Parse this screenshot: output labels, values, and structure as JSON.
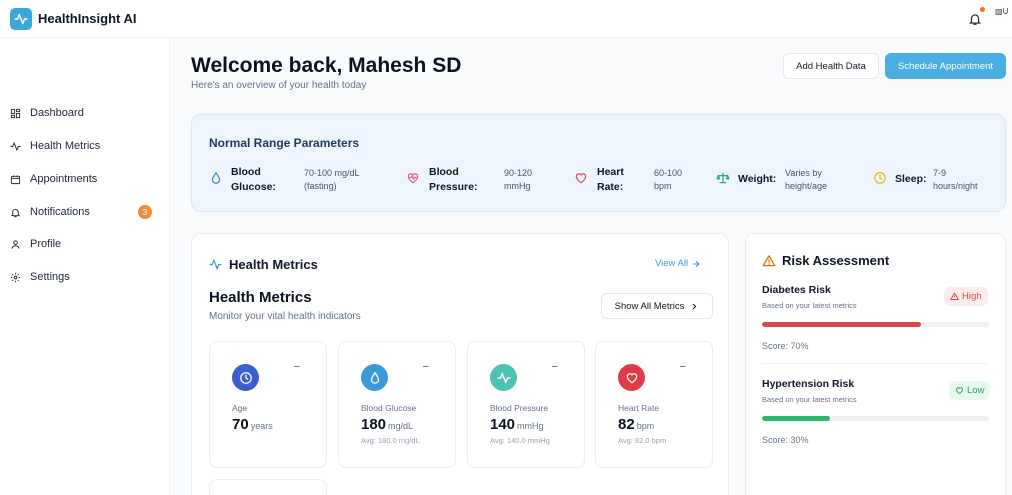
{
  "app": {
    "name": "HealthInsight AI",
    "avatar_alt": "U"
  },
  "sidebar": {
    "items": [
      {
        "label": "Dashboard",
        "icon": "grid-icon"
      },
      {
        "label": "Health Metrics",
        "icon": "activity-icon"
      },
      {
        "label": "Appointments",
        "icon": "calendar-icon"
      },
      {
        "label": "Notifications",
        "icon": "bell-icon",
        "badge": "3"
      },
      {
        "label": "Profile",
        "icon": "user-icon"
      },
      {
        "label": "Settings",
        "icon": "gear-icon"
      }
    ]
  },
  "header": {
    "title": "Welcome back, Mahesh SD",
    "subtitle": "Here's an overview of your health today",
    "add_data_label": "Add Health Data",
    "schedule_label": "Schedule Appointment"
  },
  "normal_range": {
    "title": "Normal Range Parameters",
    "params": [
      {
        "label_1": "Blood",
        "label_2": "Glucose:",
        "value_1": "70-100 mg/dL",
        "value_2": "(fasting)",
        "icon": "droplet-icon",
        "color": "#3b82c4"
      },
      {
        "label_1": "Blood",
        "label_2": "Pressure:",
        "value_1": "90-120",
        "value_2": "mmHg",
        "icon": "heart-pulse-icon",
        "color": "#e05a8c"
      },
      {
        "label_1": "Heart",
        "label_2": "Rate:",
        "value_1": "60-100",
        "value_2": "bpm",
        "icon": "heart-icon",
        "color": "#e0445c"
      },
      {
        "label_1": "Weight:",
        "label_2": "",
        "value_1": "Varies by",
        "value_2": "height/age",
        "icon": "scale-icon",
        "color": "#22a06b"
      },
      {
        "label_1": "Sleep:",
        "label_2": "",
        "value_1": "7-9",
        "value_2": "hours/night",
        "icon": "clock-icon",
        "color": "#eab308"
      }
    ]
  },
  "health_metrics": {
    "heading": "Health Metrics",
    "view_all": "View All",
    "title": "Health Metrics",
    "subtitle": "Monitor your vital health indicators",
    "show_all": "Show All Metrics",
    "cards": [
      {
        "label": "Age",
        "value": "70",
        "unit": "years",
        "avg": "",
        "trend": "–",
        "icon": "clock-icon",
        "color": "#3b5fd0"
      },
      {
        "label": "Blood Glucose",
        "value": "180",
        "unit": "mg/dL",
        "avg": "Avg: 180.0 mg/dL",
        "trend": "–",
        "icon": "droplet-icon",
        "color": "#3a9bd6"
      },
      {
        "label": "Blood Pressure",
        "value": "140",
        "unit": "mmHg",
        "avg": "Avg: 140.0 mmHg",
        "trend": "–",
        "icon": "activity-icon",
        "color": "#4cc2b4"
      },
      {
        "label": "Heart Rate",
        "value": "82",
        "unit": "bpm",
        "avg": "Avg: 82.0 bpm",
        "trend": "–",
        "icon": "heart-icon",
        "color": "#e03a48"
      }
    ]
  },
  "risk": {
    "heading": "Risk Assessment",
    "items": [
      {
        "name": "Diabetes Risk",
        "note": "Based on your latest metrics",
        "level": "High",
        "score_text": "Score: 70%",
        "score": 0.7,
        "color": "#d84a4a",
        "badge_bg": "#fdecec",
        "icon": "alert-triangle-icon"
      },
      {
        "name": "Hypertension Risk",
        "note": "Based on your latest metrics",
        "level": "Low",
        "score_text": "Score: 30%",
        "score": 0.3,
        "color": "#2fb86a",
        "badge_bg": "#e9f8ef",
        "icon": "heart-icon"
      }
    ]
  }
}
